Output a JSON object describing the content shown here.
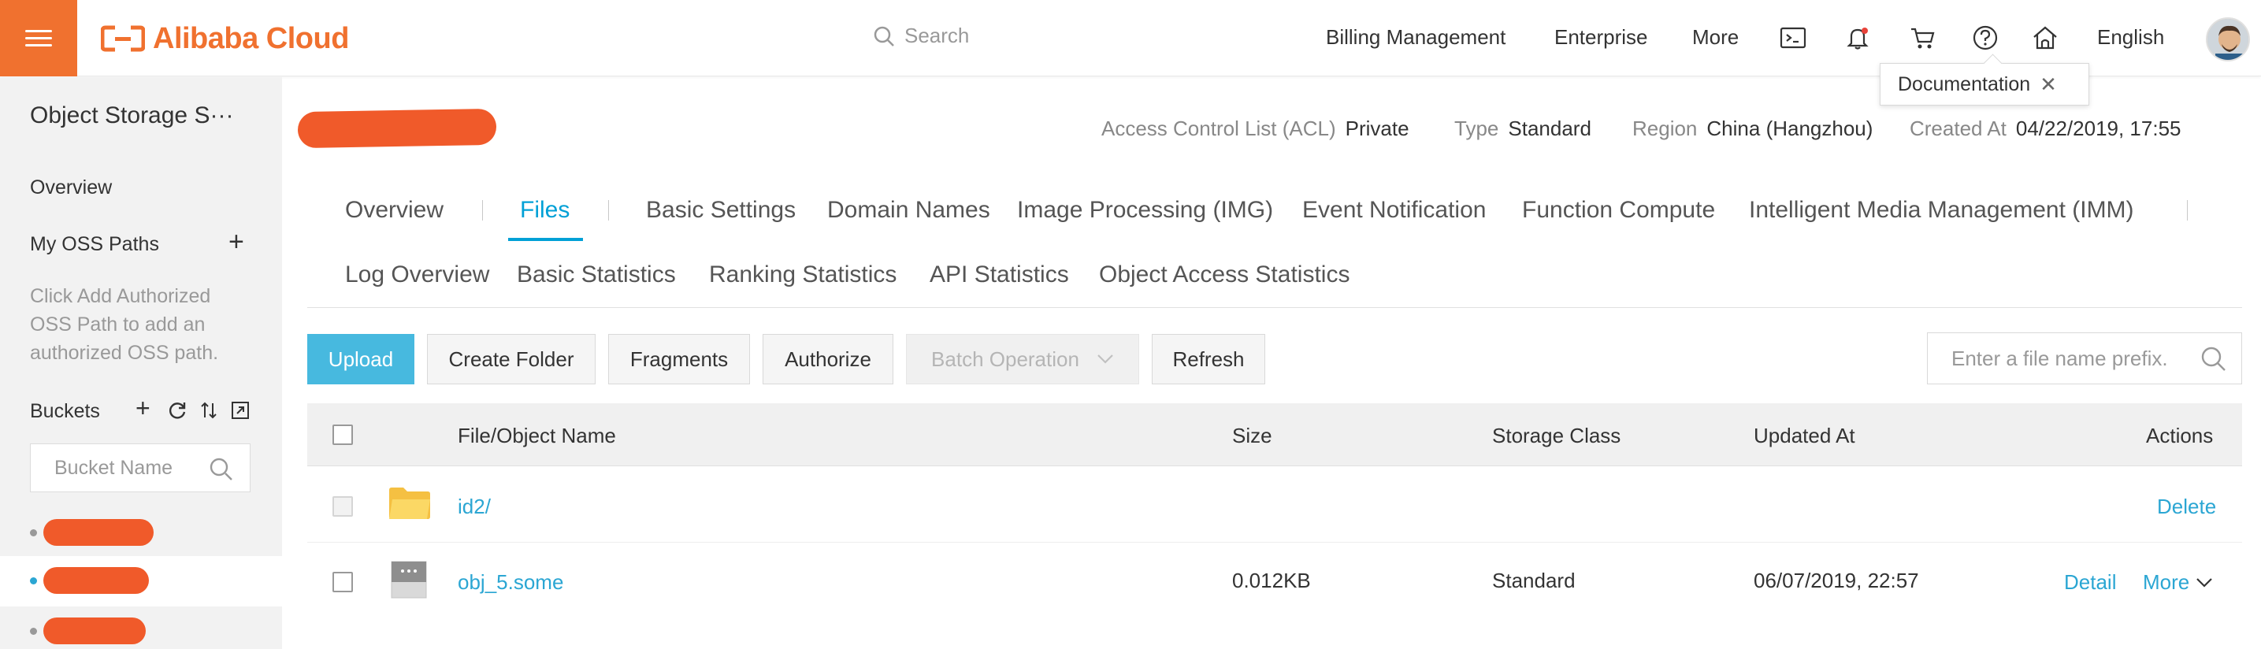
{
  "header": {
    "brand": "Alibaba Cloud",
    "search_placeholder": "Search",
    "nav": [
      "Billing Management",
      "Enterprise",
      "More"
    ],
    "language": "English",
    "tooltip": "Documentation",
    "brand_color": "#f0712f"
  },
  "sidebar": {
    "title": "Object Storage S···",
    "overview": "Overview",
    "my_oss_paths": "My OSS Paths",
    "hint": "Click Add Authorized OSS Path to add an authorized OSS path.",
    "buckets_label": "Buckets",
    "bucket_search_placeholder": "Bucket Name"
  },
  "bucket": {
    "acl_label": "Access Control List (ACL)",
    "acl_value": "Private",
    "type_label": "Type",
    "type_value": "Standard",
    "region_label": "Region",
    "region_value": "China (Hangzhou)",
    "created_label": "Created At",
    "created_value": "04/22/2019, 17:55"
  },
  "tabs": {
    "row1": [
      "Overview",
      "Files",
      "Basic Settings",
      "Domain Names",
      "Image Processing (IMG)",
      "Event Notification",
      "Function Compute",
      "Intelligent Media Management (IMM)"
    ],
    "row2": [
      "Log Overview",
      "Basic Statistics",
      "Ranking Statistics",
      "API Statistics",
      "Object Access Statistics"
    ],
    "active": "Files"
  },
  "toolbar": {
    "upload": "Upload",
    "create_folder": "Create Folder",
    "fragments": "Fragments",
    "authorize": "Authorize",
    "batch_operation": "Batch Operation",
    "refresh": "Refresh",
    "search_placeholder": "Enter a file name prefix."
  },
  "table": {
    "columns": [
      "File/Object Name",
      "Size",
      "Storage Class",
      "Updated At",
      "Actions"
    ],
    "rows": [
      {
        "name": "id2/",
        "size": "",
        "storage_class": "",
        "updated_at": "",
        "actions": [
          "Delete"
        ]
      },
      {
        "name": "obj_5.some",
        "size": "0.012KB",
        "storage_class": "Standard",
        "updated_at": "06/07/2019, 22:57",
        "actions": [
          "Detail",
          "More"
        ]
      }
    ]
  }
}
